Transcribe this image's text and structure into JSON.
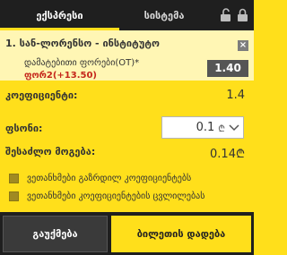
{
  "tabs": {
    "express": "ექსპრესი",
    "system": "სისტემა"
  },
  "bet": {
    "title": "1. სან-ლორენსო - ინსტიტუტო",
    "market": "დამატებითი ფორები(OT)*",
    "outcome": "ფორ2(+13.50)",
    "odd": "1.40",
    "close": "×"
  },
  "summary": {
    "coef_label": "კოეფიციენტი:",
    "coef_value": "1.4",
    "stake_label": "ფსონი:",
    "stake_value": "0.1",
    "currency": "₾",
    "win_label": "შესაძლო მოგება:",
    "win_value": "0.14₾"
  },
  "options": {
    "accept_higher": "ვეთანხმები გაზრდილ კოეფიციენტებს",
    "accept_changes": "ვეთანხმები კოეფიციენტების ცვლილებას"
  },
  "footer": {
    "cancel": "გაუქმება",
    "place": "ბილეთის დადება"
  }
}
